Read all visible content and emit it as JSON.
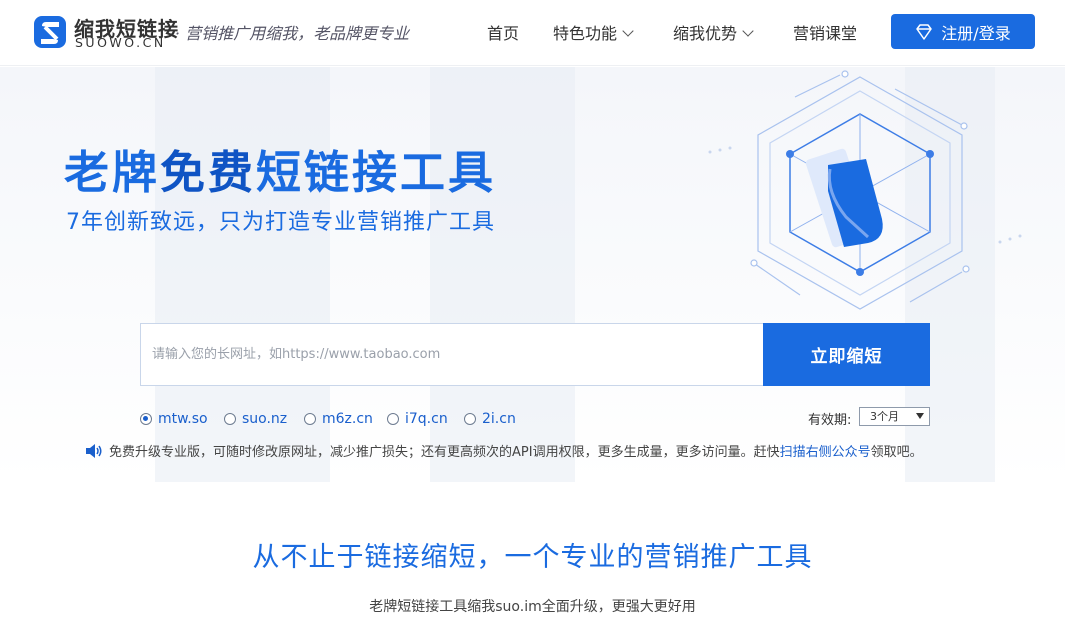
{
  "brand": {
    "name_cn": "缩我短链接",
    "name_en": "SUOWO.CN",
    "slogan": "· 营销推广用缩我，老品牌更专业"
  },
  "nav": {
    "items": [
      {
        "label": "首页",
        "has_dropdown": false
      },
      {
        "label": "特色功能",
        "has_dropdown": true
      },
      {
        "label": "缩我优势",
        "has_dropdown": true
      },
      {
        "label": "营销课堂",
        "has_dropdown": false
      }
    ],
    "login_label": "注册/登录"
  },
  "hero": {
    "title_part1": "老牌",
    "title_part2": "免费",
    "title_part3": "短链接工具",
    "subtitle": "7年创新致远，只为打造专业营销推广工具"
  },
  "shortener": {
    "input_value": "",
    "placeholder": "请输入您的长网址，如https://www.taobao.com",
    "button_label": "立即缩短",
    "domains": [
      {
        "label": "mtw.so",
        "selected": true
      },
      {
        "label": "suo.nz",
        "selected": false
      },
      {
        "label": "m6z.cn",
        "selected": false
      },
      {
        "label": "i7q.cn",
        "selected": false
      },
      {
        "label": "2i.cn",
        "selected": false
      }
    ],
    "expiry_label": "有效期:",
    "expiry_value": "3个月"
  },
  "notice": {
    "text": "免费升级专业版，可随时修改原网址，减少推广损失；还有更高频次的API调用权限，更多生成量，更多访问量。赶快",
    "link_text": "扫描右侧公众号",
    "suffix": "领取吧。"
  },
  "section": {
    "title": "从不止于链接缩短，一个专业的营销推广工具",
    "subtitle": "老牌短链接工具缩我suo.im全面升级，更强大更好用"
  },
  "colors": {
    "primary": "#1a6be0",
    "link": "#1a5fcc",
    "text": "#333333"
  }
}
